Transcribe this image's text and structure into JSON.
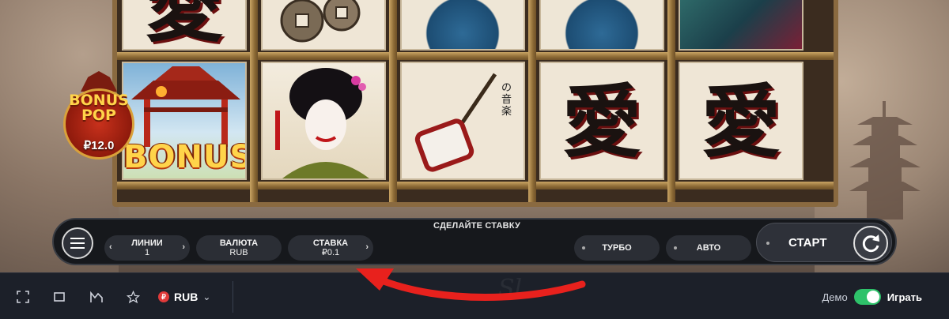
{
  "game": {
    "bonus_pop": {
      "title_line1": "BONUS",
      "title_line2": "POP",
      "amount": "₽12.0"
    },
    "bonus_symbol": "BONUS",
    "kanji_symbol": "愛",
    "instrument_caption": "の音楽"
  },
  "controls": {
    "bet_prompt": "СДЕЛАЙТЕ СТАВКУ",
    "lines": {
      "label": "ЛИНИИ",
      "value": "1"
    },
    "currency": {
      "label": "ВАЛЮТА",
      "value": "RUB"
    },
    "stake": {
      "label": "СТАВКА",
      "value": "₽0.1"
    },
    "turbo_label": "ТУРБО",
    "auto_label": "АВТО",
    "start_label": "СТАРТ"
  },
  "toolbar": {
    "icons": [
      "fullscreen-icon",
      "window-icon",
      "stats-icon",
      "star-icon"
    ],
    "currency_symbol": "₽",
    "currency_code": "RUB",
    "demo_label": "Демо",
    "play_label": "Играть",
    "toggle_on": true,
    "accent_color": "#2ec26a"
  },
  "watermark": "Sl"
}
